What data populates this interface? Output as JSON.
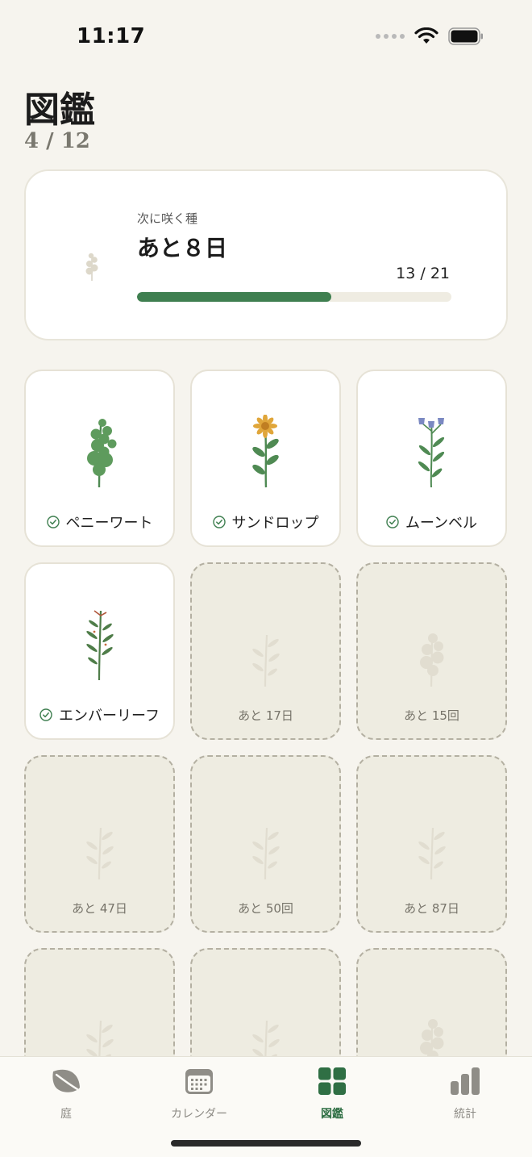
{
  "status_bar": {
    "time": "11:17"
  },
  "header": {
    "title": "図鑑",
    "count": "4 / 12"
  },
  "next_card": {
    "label": "次に咲く種",
    "value": "あと８日",
    "progress_text": "13 / 21",
    "progress": 0.619
  },
  "plants": [
    {
      "name": "ペニーワート",
      "unlocked": true,
      "icon": "pennywort-plant-icon"
    },
    {
      "name": "サンドロップ",
      "unlocked": true,
      "icon": "sundrop-flower-icon"
    },
    {
      "name": "ムーンベル",
      "unlocked": true,
      "icon": "moonbell-flower-icon"
    },
    {
      "name": "エンバーリーフ",
      "unlocked": true,
      "icon": "emberleaf-plant-icon"
    },
    {
      "name": "あと 17日",
      "unlocked": false,
      "icon": "locked-sprig-icon"
    },
    {
      "name": "あと 15回",
      "unlocked": false,
      "icon": "locked-round-leaf-icon"
    },
    {
      "name": "あと 47日",
      "unlocked": false,
      "icon": "locked-sprig-icon"
    },
    {
      "name": "あと 50回",
      "unlocked": false,
      "icon": "locked-sprig-icon"
    },
    {
      "name": "あと 87日",
      "unlocked": false,
      "icon": "locked-sprig-icon"
    },
    {
      "name": "",
      "unlocked": false,
      "icon": "locked-sprig-icon"
    },
    {
      "name": "",
      "unlocked": false,
      "icon": "locked-sprig-icon"
    },
    {
      "name": "",
      "unlocked": false,
      "icon": "locked-round-leaf-icon"
    }
  ],
  "tabs": [
    {
      "label": "庭",
      "icon": "leaf-icon",
      "active": false
    },
    {
      "label": "カレンダー",
      "icon": "calendar-icon",
      "active": false
    },
    {
      "label": "図鑑",
      "icon": "grid-icon",
      "active": true
    },
    {
      "label": "統計",
      "icon": "bar-chart-icon",
      "active": false
    }
  ],
  "colors": {
    "accent": "#3f7f50",
    "background": "#f6f4ee",
    "locked": "#eeece1"
  }
}
